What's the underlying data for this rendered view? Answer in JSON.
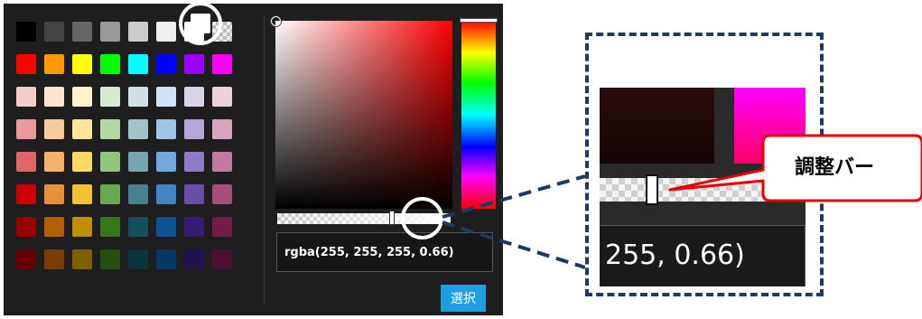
{
  "palette": {
    "rows": [
      [
        "#000000",
        "#444444",
        "#666666",
        "#999999",
        "#cccccc",
        "#eeeeee",
        "#ffffff",
        "transparent"
      ],
      [
        "#ff0000",
        "#ff9900",
        "#ffff00",
        "#00ff00",
        "#00ffff",
        "#0000ff",
        "#9900ff",
        "#ff00ff"
      ],
      [
        "#f4cccc",
        "#fce5cd",
        "#fff2cc",
        "#d9ead3",
        "#d0e0e3",
        "#cfe2f3",
        "#d9d2e9",
        "#ead1dc"
      ],
      [
        "#ea9999",
        "#f9cb9c",
        "#ffe599",
        "#b6d7a8",
        "#a2c4c9",
        "#9fc5e8",
        "#b4a7d6",
        "#d5a6bd"
      ],
      [
        "#e06666",
        "#f6b26b",
        "#ffd966",
        "#93c47d",
        "#76a5af",
        "#6fa8dc",
        "#8e7cc3",
        "#c27ba0"
      ],
      [
        "#cc0000",
        "#e69138",
        "#f1c232",
        "#6aa84f",
        "#45818e",
        "#3d85c6",
        "#674ea7",
        "#a64d79"
      ],
      [
        "#990000",
        "#b45f06",
        "#bf9000",
        "#38761d",
        "#134f5c",
        "#0b5394",
        "#351c75",
        "#741b47"
      ],
      [
        "#660000",
        "#783f04",
        "#7f6000",
        "#274e13",
        "#0c343d",
        "#073763",
        "#20124d",
        "#4c1130"
      ]
    ],
    "selected": "#ffffff"
  },
  "picker": {
    "base_hue_color": "#ff0000",
    "alpha_level": 0.66,
    "input_value": "rgba(255, 255, 255, 0.66)",
    "select_button_label": "選択"
  },
  "zoom": {
    "input_excerpt": "255, 0.66)",
    "callout_label": "調整バー"
  },
  "annotation_colors": {
    "dashed_frame": "#1f3a5f",
    "callout": "#e60000",
    "button_accent": "#1e9fe0"
  }
}
